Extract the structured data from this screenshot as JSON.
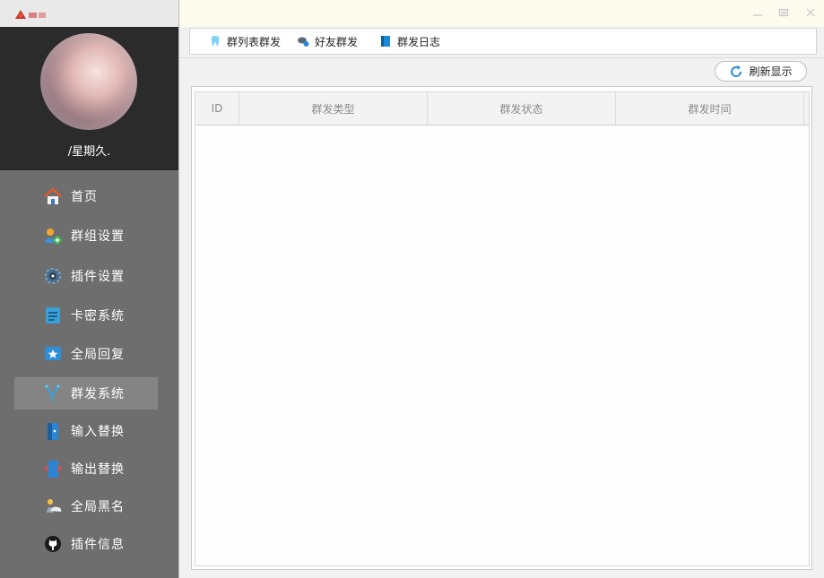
{
  "profile": {
    "username": "/星期久."
  },
  "nav": {
    "items": [
      {
        "label": "首页",
        "icon": "home-icon"
      },
      {
        "label": "群组设置",
        "icon": "group-add-icon"
      },
      {
        "label": "插件设置",
        "icon": "gear-icon"
      },
      {
        "label": "卡密系统",
        "icon": "card-icon"
      },
      {
        "label": "全局回复",
        "icon": "star-message-icon"
      },
      {
        "label": "群发系统",
        "icon": "broadcast-icon",
        "active": true
      },
      {
        "label": "输入替换",
        "icon": "input-replace-icon"
      },
      {
        "label": "输出替换",
        "icon": "output-replace-icon"
      },
      {
        "label": "全局黑名",
        "icon": "blacklist-icon"
      },
      {
        "label": "插件信息",
        "icon": "github-icon"
      }
    ]
  },
  "tabs": [
    {
      "label": "群列表群发",
      "icon": "tooth-icon"
    },
    {
      "label": "好友群发",
      "icon": "friends-icon"
    },
    {
      "label": "群发日志",
      "icon": "book-icon"
    }
  ],
  "toolbar": {
    "refresh_label": "刷新显示"
  },
  "table": {
    "columns": [
      "ID",
      "群发类型",
      "群发状态",
      "群发时间"
    ],
    "rows": []
  },
  "colors": {
    "sidebar_bg": "#6e6e6e",
    "profile_bg": "#2b2b2b",
    "active_item_bg": "#848484",
    "titlebar_bg": "#fbfbee"
  }
}
